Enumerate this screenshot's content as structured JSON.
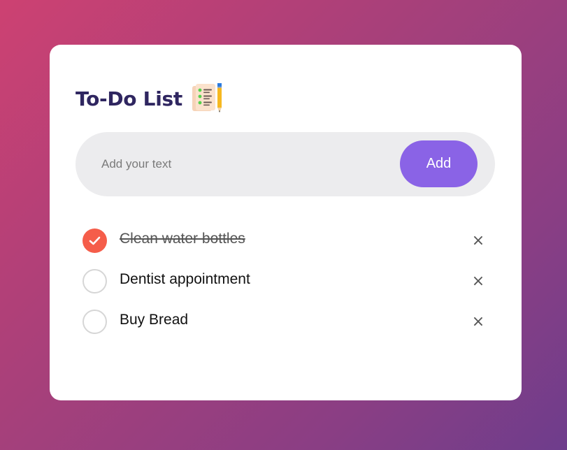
{
  "app": {
    "title": "To-Do List",
    "title_icon": "checklist-with-pencil-icon"
  },
  "input": {
    "value": "",
    "placeholder": "Add your text",
    "add_label": "Add"
  },
  "tasks": [
    {
      "text": "Clean water bottles",
      "done": true
    },
    {
      "text": "Dentist appointment",
      "done": false
    },
    {
      "text": "Buy Bread",
      "done": false
    }
  ],
  "delete_glyph": "×",
  "colors": {
    "title": "#2f2660",
    "accent": "#8a63e6",
    "checked": "#f55d4a",
    "input_bg": "#ececee"
  }
}
